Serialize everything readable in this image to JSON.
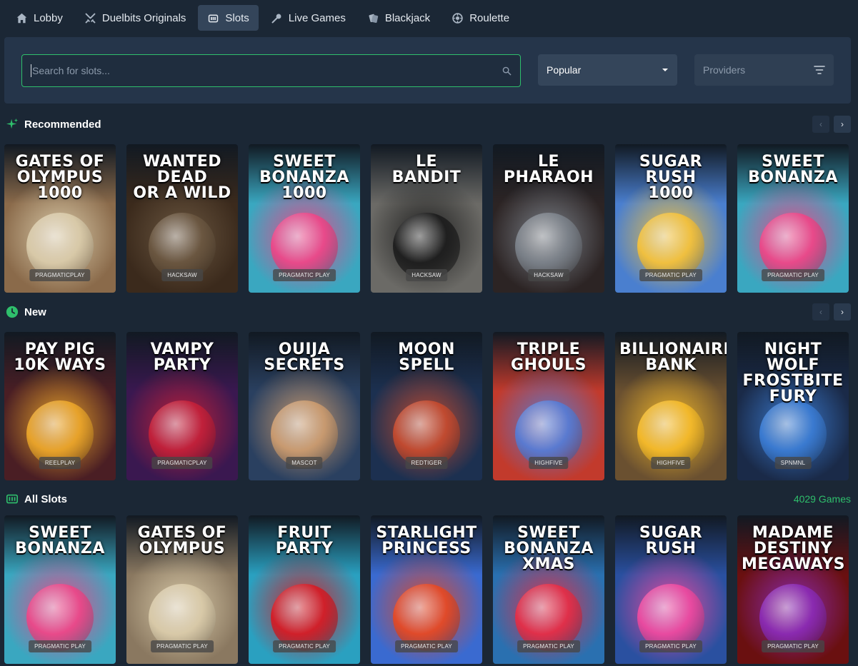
{
  "nav": {
    "tabs": [
      {
        "label": "Lobby",
        "icon": "home-icon",
        "active": false
      },
      {
        "label": "Duelbits Originals",
        "icon": "swords-icon",
        "active": false
      },
      {
        "label": "Slots",
        "icon": "slot-machine-icon",
        "active": true
      },
      {
        "label": "Live Games",
        "icon": "microphone-icon",
        "active": false
      },
      {
        "label": "Blackjack",
        "icon": "cards-icon",
        "active": false
      },
      {
        "label": "Roulette",
        "icon": "roulette-icon",
        "active": false
      }
    ]
  },
  "filters": {
    "search_placeholder": "Search for slots...",
    "sort_value": "Popular",
    "providers_placeholder": "Providers"
  },
  "sections": {
    "recommended": {
      "title": "Recommended",
      "games": [
        {
          "title": "GATES OF\nOLYMPUS 1000",
          "provider": "PRAGMATICPLAY",
          "bg": "#8a6a4a",
          "accent": "#d8c9a8"
        },
        {
          "title": "WANTED DEAD\nOR A WILD",
          "provider": "HACKSAW",
          "bg": "#3b2a1c",
          "accent": "#6a5640"
        },
        {
          "title": "SWEET\nBONANZA\n1000",
          "provider": "PRAGMATIC PLAY",
          "bg": "#3aa7c0",
          "accent": "#e84a8a"
        },
        {
          "title": "LE\nBANDIT",
          "provider": "HACKSAW",
          "bg": "#6b6a66",
          "accent": "#1f1f1f"
        },
        {
          "title": "LE\nPHARAOH",
          "provider": "HACKSAW",
          "bg": "#2c2424",
          "accent": "#7a8088"
        },
        {
          "title": "SUGAR RUSH\n1000",
          "provider": "PRAGMATIC PLAY",
          "bg": "#4a7fcf",
          "accent": "#f0c040"
        },
        {
          "title": "SWEET\nBONANZA",
          "provider": "PRAGMATIC PLAY",
          "bg": "#3aa7c0",
          "accent": "#e84a8a"
        }
      ]
    },
    "new": {
      "title": "New",
      "games": [
        {
          "title": "PAY PIG\n10K WAYS",
          "provider": "REELPLAY",
          "bg": "#4a1e24",
          "accent": "#e7a22a"
        },
        {
          "title": "VAMPY\nPARTY",
          "provider": "PRAGMATICPLAY",
          "bg": "#3a1850",
          "accent": "#c0203a"
        },
        {
          "title": "OUIJA\nSECRETS",
          "provider": "MASCOT",
          "bg": "#2a4060",
          "accent": "#c89a70"
        },
        {
          "title": "MOON\nSPELL",
          "provider": "REDTIGER",
          "bg": "#1c3050",
          "accent": "#c04a30"
        },
        {
          "title": "TRIPLE\nGHOULS",
          "provider": "HIGHFIVE",
          "bg": "#c23a2c",
          "accent": "#5a7ad0"
        },
        {
          "title": "BILLIONAIRE'S\nBANK",
          "provider": "HIGHFIVE",
          "bg": "#6a5030",
          "accent": "#f2b82a"
        },
        {
          "title": "NIGHT WOLF\nFROSTBITE FURY",
          "provider": "SPNMNL",
          "bg": "#1a2a48",
          "accent": "#3a7ad0"
        }
      ]
    },
    "all": {
      "title": "All Slots",
      "count": "4029 Games",
      "games": [
        {
          "title": "SWEET\nBONANZA",
          "provider": "PRAGMATIC PLAY",
          "bg": "#3aa7c0",
          "accent": "#e84a8a"
        },
        {
          "title": "GATES OF\nOLYMPUS",
          "provider": "PRAGMATIC PLAY",
          "bg": "#8a7860",
          "accent": "#d8c9a8"
        },
        {
          "title": "FRUIT\nPARTY",
          "provider": "PRAGMATIC PLAY",
          "bg": "#2aa0c0",
          "accent": "#d0202a"
        },
        {
          "title": "STARLIGHT\nPRINCESS",
          "provider": "PRAGMATIC PLAY",
          "bg": "#3a6ad0",
          "accent": "#e04a2a"
        },
        {
          "title": "SWEET\nBONANZA XMAS",
          "provider": "PRAGMATIC PLAY",
          "bg": "#2a70b0",
          "accent": "#e0304a"
        },
        {
          "title": "SUGAR\nRUSH",
          "provider": "PRAGMATIC PLAY",
          "bg": "#2a50a0",
          "accent": "#e84aa0"
        },
        {
          "title": "MADAME\nDESTINY MEGAWAYS",
          "provider": "PRAGMATIC PLAY",
          "bg": "#6a1010",
          "accent": "#8a2ab0"
        }
      ]
    }
  }
}
